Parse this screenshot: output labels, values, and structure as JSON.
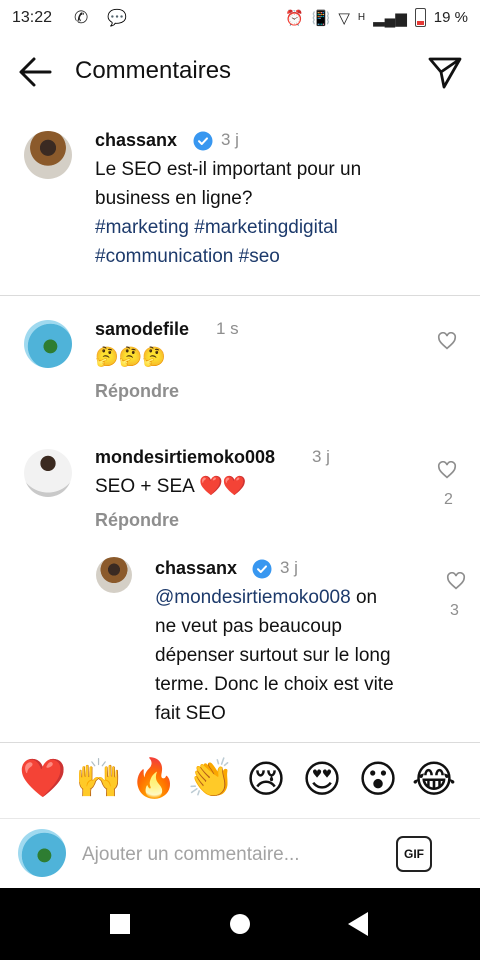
{
  "statusbar": {
    "time": "13:22",
    "network": "H",
    "battery": "19 %"
  },
  "header": {
    "title": "Commentaires"
  },
  "post": {
    "username": "chassanx",
    "time": "3 j",
    "text_line1": "Le SEO est-il important pour un",
    "text_line2": "business en ligne?",
    "hashtags_line1": "#marketing #marketingdigital",
    "hashtags_line2": "#communication #seo"
  },
  "comments": [
    {
      "username": "samodefile",
      "time": "1 s",
      "text": "🤔🤔🤔",
      "reply": "Répondre"
    },
    {
      "username": "mondesirtiemoko008",
      "time": "3 j",
      "text": "SEO + SEA ❤️❤️",
      "reply": "Répondre",
      "likes": "2"
    }
  ],
  "nested_reply": {
    "username": "chassanx",
    "time": "3 j",
    "mention": "@mondesirtiemoko008",
    "text_part1": " on",
    "text_line2": "ne veut pas beaucoup",
    "text_line3": "dépenser surtout sur le long",
    "text_line4": "terme. Donc le choix est vite",
    "text_line5": "fait SEO",
    "likes": "3"
  },
  "emoji_bar": [
    "❤️",
    "🙌",
    "🔥",
    "👏",
    "😢",
    "😍",
    "😮",
    "😂"
  ],
  "composer": {
    "placeholder": "Ajouter un commentaire...",
    "gif_label": "GIF"
  },
  "colors": {
    "link": "#1d3a6b",
    "muted": "#8e8e8e",
    "verified": "#3897f0"
  }
}
